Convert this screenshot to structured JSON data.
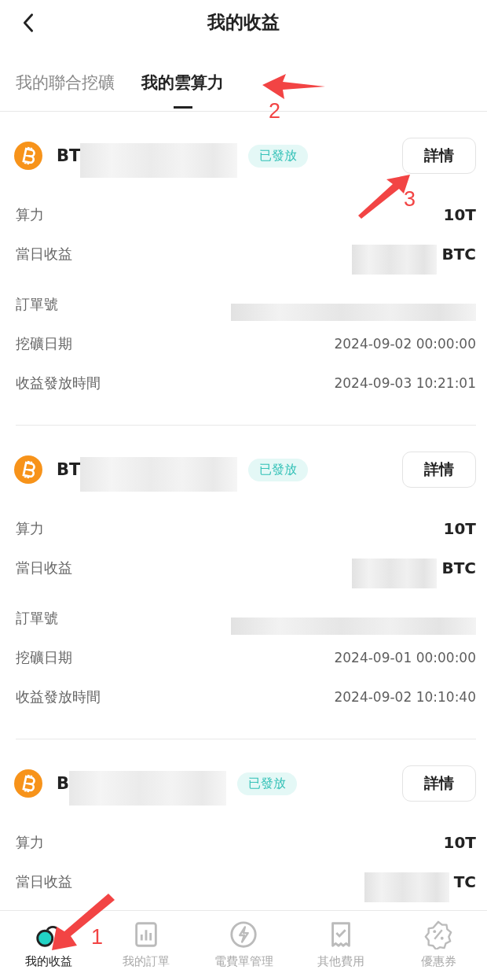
{
  "header": {
    "title": "我的收益"
  },
  "tabs": [
    {
      "label": "我的聯合挖礦",
      "selected": false
    },
    {
      "label": "我的雲算力",
      "selected": true
    }
  ],
  "records": [
    {
      "coin": "BT",
      "status": "已發放",
      "details_button": "詳情",
      "rows": [
        {
          "label": "算力",
          "kind": "bold",
          "value": "10T"
        },
        {
          "label": "當日收益",
          "kind": "redacted_bold",
          "value": "BTC"
        },
        {
          "label": "訂單號",
          "kind": "redacted"
        },
        {
          "label": "挖礦日期",
          "kind": "plain",
          "value": "2024-09-02 00:00:00"
        },
        {
          "label": "收益發放時間",
          "kind": "plain",
          "value": "2024-09-03 10:21:01"
        }
      ]
    },
    {
      "coin": "BT",
      "status": "已發放",
      "details_button": "詳情",
      "rows": [
        {
          "label": "算力",
          "kind": "bold",
          "value": "10T"
        },
        {
          "label": "當日收益",
          "kind": "redacted_bold",
          "value": "BTC"
        },
        {
          "label": "訂單號",
          "kind": "redacted"
        },
        {
          "label": "挖礦日期",
          "kind": "plain",
          "value": "2024-09-01 00:00:00"
        },
        {
          "label": "收益發放時間",
          "kind": "plain",
          "value": "2024-09-02 10:10:40"
        }
      ]
    },
    {
      "coin": "B",
      "status": "已發放",
      "details_button": "詳情",
      "rows": [
        {
          "label": "算力",
          "kind": "bold",
          "value": "10T"
        },
        {
          "label": "當日收益",
          "kind": "redacted_bold",
          "value": "TC"
        }
      ]
    }
  ],
  "bottom_nav": [
    {
      "label": "我的收益",
      "selected": true
    },
    {
      "label": "我的訂單",
      "selected": false
    },
    {
      "label": "電費單管理",
      "selected": false
    },
    {
      "label": "其他費用",
      "selected": false
    },
    {
      "label": "優惠券",
      "selected": false
    }
  ],
  "annotations": [
    {
      "label": "1"
    },
    {
      "label": "2"
    },
    {
      "label": "3"
    }
  ]
}
